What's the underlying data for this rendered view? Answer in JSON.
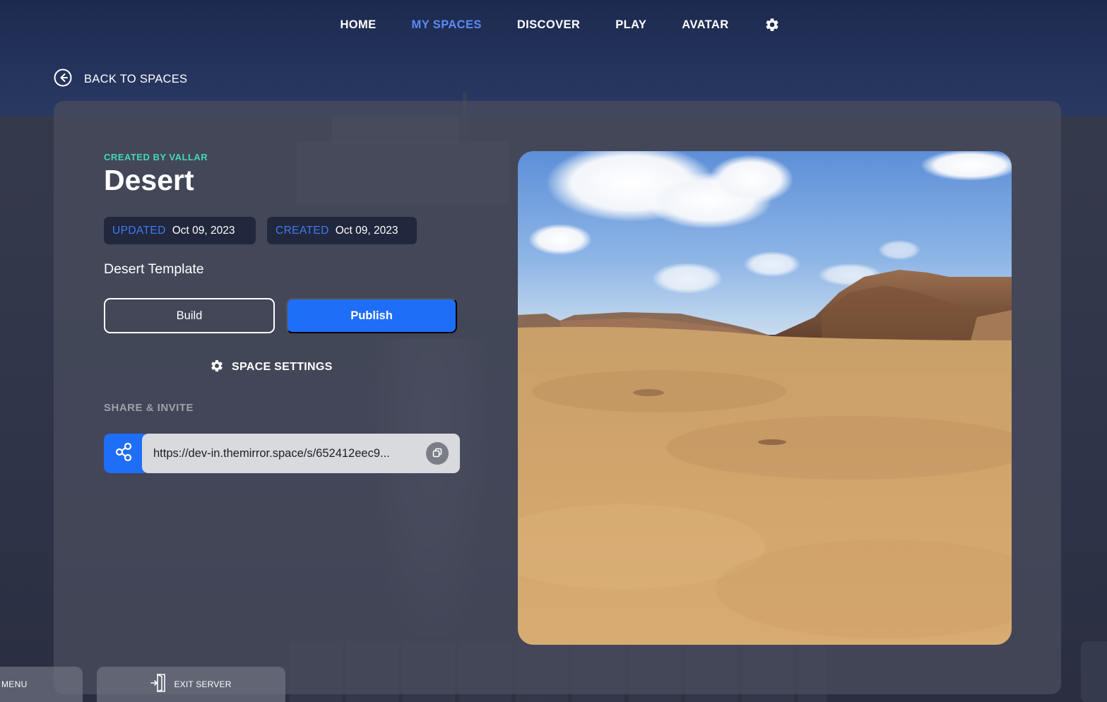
{
  "nav": {
    "items": [
      {
        "label": "HOME",
        "active": false
      },
      {
        "label": "MY SPACES",
        "active": true
      },
      {
        "label": "DISCOVER",
        "active": false
      },
      {
        "label": "PLAY",
        "active": false
      },
      {
        "label": "AVATAR",
        "active": false
      }
    ],
    "settings_icon": "gear-icon",
    "active_color": "#5b8bf5"
  },
  "back": {
    "label": "BACK TO SPACES",
    "icon": "arrow-left-circle-icon"
  },
  "space": {
    "created_by": "CREATED BY VALLAR",
    "title": "Desert",
    "updated_key": "UPDATED",
    "updated_value": "Oct 09, 2023",
    "created_key": "CREATED",
    "created_value": "Oct 09, 2023",
    "description": "Desert Template",
    "preview_image": "desert-landscape-preview"
  },
  "actions": {
    "build_label": "Build",
    "publish_label": "Publish",
    "settings_label": "SPACE SETTINGS",
    "settings_icon": "gear-icon"
  },
  "share": {
    "heading": "SHARE & INVITE",
    "url": "https://dev-in.themirror.space/s/652412eec9...",
    "share_icon": "share-icon",
    "copy_icon": "copy-icon"
  },
  "bottom_bar": {
    "menu_label": "MENU",
    "exit_label": "EXIT SERVER",
    "exit_icon": "exit-door-icon"
  },
  "colors": {
    "accent_blue": "#1f6ef7",
    "created_by_teal": "#45d6b8",
    "chip_bg": "#21273c"
  }
}
